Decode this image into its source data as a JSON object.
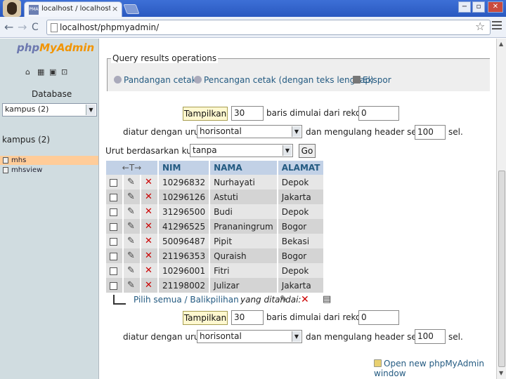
{
  "browser": {
    "tab_title": "localhost / localhost / kampus",
    "tab_favicon_text": "PMA",
    "tab_close": "×",
    "url": "localhost/phpmyadmin/",
    "back": "←",
    "forward": "→",
    "reload": "C",
    "star": "☆",
    "win_min": "−",
    "win_max": "▫",
    "win_close": "✕"
  },
  "sidebar": {
    "logo_php": "php",
    "logo_myadmin": "MyAdmin",
    "database_label": "Database",
    "database_value": "kampus (2)",
    "db_heading": "kampus (2)",
    "tables": [
      {
        "name": "mhs",
        "active": true
      },
      {
        "name": "mhsview",
        "active": false
      }
    ]
  },
  "qro": {
    "legend": "Query results operations",
    "links": [
      "Pandangan cetak",
      "Pencangan cetak (dengan teks lengkap)",
      "Ekspor"
    ]
  },
  "nav_top": {
    "show_button": "Tampilkan",
    "rows": "30",
    "rows_text": "baris dimulai dari rekord #",
    "start": "0",
    "order_text": "diatur dengan urutan",
    "mode": "horisontal",
    "repeat_text": "dan mengulang header setelah",
    "repeat": "100",
    "cells_text": "sel."
  },
  "sort": {
    "label": "Urut berdasarkan kunci:",
    "value": "tanpa",
    "go": "Go"
  },
  "table": {
    "headers": [
      "NIM",
      "NAMA",
      "ALAMAT"
    ],
    "action_header": "←T→",
    "rows": [
      {
        "nim": "10296832",
        "nama": "Nurhayati",
        "alamat": "Depok"
      },
      {
        "nim": "10296126",
        "nama": "Astuti",
        "alamat": "Jakarta"
      },
      {
        "nim": "31296500",
        "nama": "Budi",
        "alamat": "Depok"
      },
      {
        "nim": "41296525",
        "nama": "Prananingrum",
        "alamat": "Bogor"
      },
      {
        "nim": "50096487",
        "nama": "Pipit",
        "alamat": "Bekasi"
      },
      {
        "nim": "21196353",
        "nama": "Quraish",
        "alamat": "Bogor"
      },
      {
        "nim": "10296001",
        "nama": "Fitri",
        "alamat": "Depok"
      },
      {
        "nim": "21198002",
        "nama": "Julizar",
        "alamat": "Jakarta"
      }
    ]
  },
  "with_selected": {
    "check_all": "Pilih semua / Balikpilihan",
    "label": "yang ditandai:"
  },
  "new_window": "Open new phpMyAdmin window"
}
